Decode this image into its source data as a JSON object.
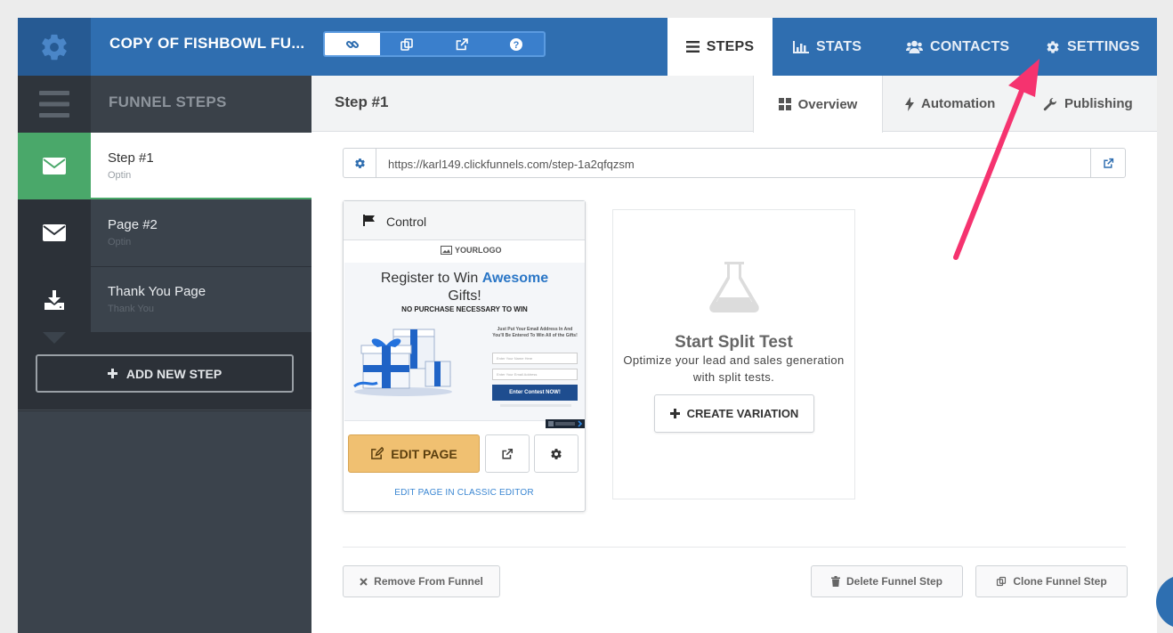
{
  "header": {
    "funnel_title": "COPY OF FISHBOWL FU...",
    "nav": {
      "steps": "STEPS",
      "stats": "STATS",
      "contacts": "CONTACTS",
      "settings": "SETTINGS"
    }
  },
  "sidebar": {
    "title": "FUNNEL STEPS",
    "steps": [
      {
        "name": "Step #1",
        "type": "Optin"
      },
      {
        "name": "Page #2",
        "type": "Optin"
      },
      {
        "name": "Thank You Page",
        "type": "Thank You"
      }
    ],
    "add_step": "ADD NEW STEP"
  },
  "main": {
    "step_title": "Step #1",
    "tabs": {
      "overview": "Overview",
      "automation": "Automation",
      "publishing": "Publishing"
    },
    "url": "https://karl149.clickfunnels.com/step-1a2qfqzsm",
    "control": {
      "label": "Control",
      "preview": {
        "logo": "YOURLOGO",
        "heading_plain": "Register to Win",
        "heading_accent": "Awesome",
        "heading_end": "Gifts!",
        "subheading": "NO PURCHASE NECESSARY TO WIN",
        "side_text": "Just Put Your Email Address In And You'll Be Entered To Win All of the Gifts!",
        "name_placeholder": "Enter Your Name Here",
        "email_placeholder": "Enter Your Email Address",
        "button": "Enter Contest NOW!"
      },
      "edit_page": "EDIT PAGE",
      "classic_editor": "EDIT PAGE IN CLASSIC EDITOR"
    },
    "split_test": {
      "title": "Start Split Test",
      "description": "Optimize your lead and sales generation with split tests.",
      "create_variation": "CREATE VARIATION"
    },
    "footer": {
      "remove": "Remove From Funnel",
      "delete": "Delete Funnel Step",
      "clone": "Clone Funnel Step"
    }
  },
  "colors": {
    "topbar": "#2f6eb0",
    "sidebar_dark": "#2c3138",
    "step_active": "#4aa86a",
    "edit_button": "#f0c071",
    "arrow": "#f5336f"
  }
}
